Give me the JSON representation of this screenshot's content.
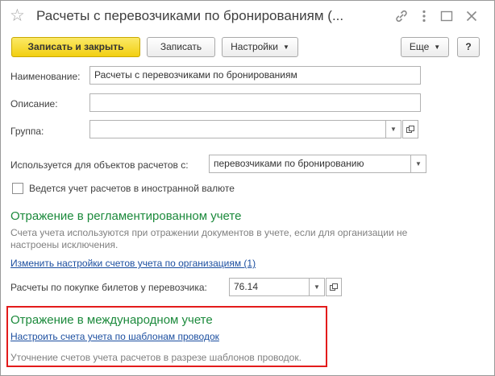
{
  "window": {
    "title": "Расчеты с перевозчиками по бронированиям (..."
  },
  "toolbar": {
    "save_close_label": "Записать и закрыть",
    "save_label": "Записать",
    "settings_label": "Настройки",
    "more_label": "Еще",
    "help_label": "?"
  },
  "form": {
    "name_label": "Наименование:",
    "name_value": "Расчеты с перевозчиками по бронированиям",
    "description_label": "Описание:",
    "description_value": "",
    "group_label": "Группа:",
    "group_value": "",
    "used_for_label": "Используется для объектов расчетов с:",
    "used_for_value": "перевозчиками по бронированию",
    "currency_checkbox_label": "Ведется учет расчетов в иностранной валюте",
    "currency_checked": false
  },
  "regulated": {
    "title": "Отражение в регламентированном учете",
    "note": "Счета учета используются при отражении документов в учете, если для организации не настроены исключения.",
    "link": "Изменить настройки счетов учета по организациям (1)",
    "tickets_label": "Расчеты по покупке билетов у перевозчика:",
    "tickets_value": "76.14"
  },
  "international": {
    "title": "Отражение в международном учете",
    "link": "Настроить счета учета по шаблонам проводок",
    "note": "Уточнение счетов учета расчетов в разрезе шаблонов проводок."
  },
  "colors": {
    "accent_green": "#1c8a3c",
    "link_blue": "#1c4fa0",
    "primary_yellow": "#f2cf11",
    "highlight_red": "#e31b1b"
  }
}
